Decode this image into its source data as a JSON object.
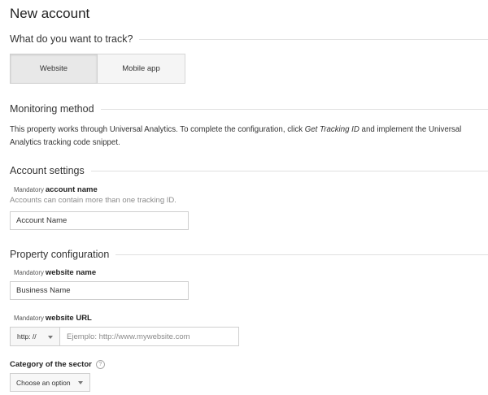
{
  "page": {
    "title": "New account"
  },
  "track": {
    "heading": "What do you want to track?",
    "tabs": [
      {
        "label": "Website",
        "active": true
      },
      {
        "label": "Mobile app",
        "active": false
      }
    ]
  },
  "monitoring": {
    "heading": "Monitoring method",
    "text_before": "This property works through Universal Analytics. To complete the configuration, click ",
    "text_emphasis": "Get Tracking ID",
    "text_after": " and implement the Universal Analytics tracking code snippet."
  },
  "account": {
    "heading": "Account settings",
    "mandatory": "Mandatory",
    "label": "account name",
    "hint": "Accounts can contain more than one tracking ID.",
    "value": "Account Name"
  },
  "property": {
    "heading": "Property configuration",
    "website_name": {
      "mandatory": "Mandatory",
      "label": "website name",
      "value": "Business Name"
    },
    "website_url": {
      "mandatory": "Mandatory",
      "label": "website URL",
      "protocol": "http: //",
      "placeholder": "Ejemplo: http://www.mywebsite.com"
    },
    "category": {
      "label": "Category of the sector",
      "help_icon": "?",
      "selected": "Choose an option"
    }
  }
}
